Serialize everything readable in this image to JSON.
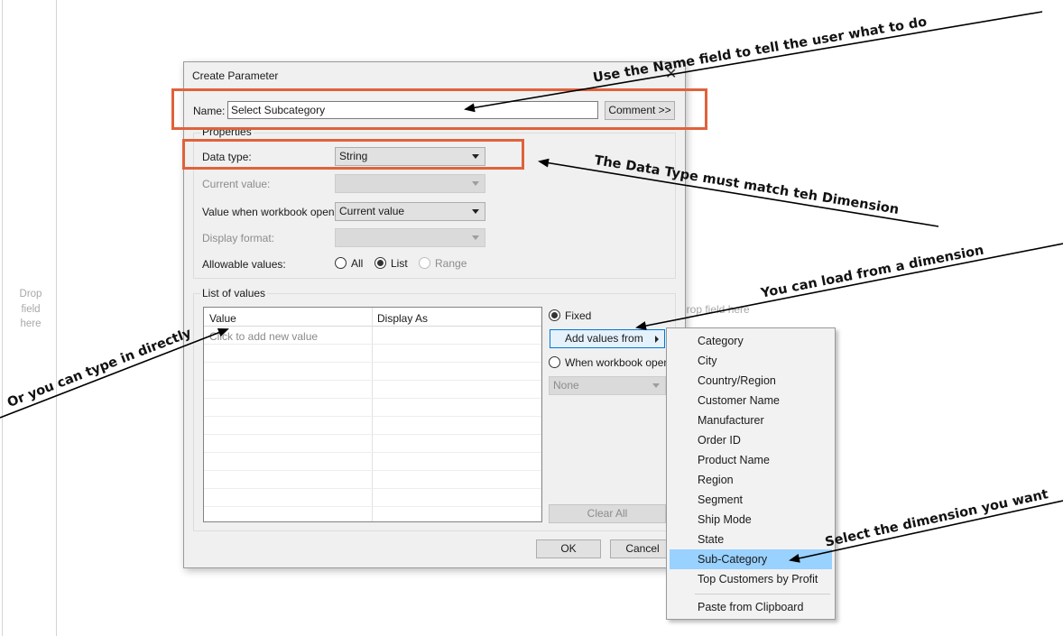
{
  "workspace": {
    "drop_hint_left": "Drop\nfield\nhere",
    "drop_hint_right": "Drop field here"
  },
  "dialog": {
    "title": "Create Parameter",
    "close_glyph": "✕",
    "name_label": "Name:",
    "name_value": "Select Subcategory",
    "comment_button": "Comment >>",
    "properties_label": "Properties",
    "data_type_label": "Data type:",
    "data_type_value": "String",
    "current_value_label": "Current value:",
    "current_value_value": "",
    "value_when_opens_label": "Value when workbook opens:",
    "value_when_opens_value": "Current value",
    "display_format_label": "Display format:",
    "display_format_value": "",
    "allowable_values_label": "Allowable values:",
    "allowable_options": [
      {
        "label": "All",
        "checked": false,
        "disabled": false
      },
      {
        "label": "List",
        "checked": true,
        "disabled": false
      },
      {
        "label": "Range",
        "checked": false,
        "disabled": true
      }
    ],
    "list_of_values_label": "List of values",
    "grid": {
      "columns": [
        "Value",
        "Display As"
      ],
      "placeholder": "Click to add new value"
    },
    "fixed_label": "Fixed",
    "add_values_button": "Add values from",
    "when_workbook_opens_label": "When workbook opens",
    "none_combo_value": "None",
    "clear_all_button": "Clear All",
    "ok_button": "OK",
    "cancel_button": "Cancel"
  },
  "add_values_menu": {
    "items": [
      "Category",
      "City",
      "Country/Region",
      "Customer Name",
      "Manufacturer",
      "Order ID",
      "Product Name",
      "Region",
      "Segment",
      "Ship Mode",
      "State",
      "Sub-Category",
      "Top Customers by Profit"
    ],
    "selected": "Sub-Category",
    "paste_item": "Paste from Clipboard"
  },
  "annotations": {
    "name_tip": "Use the Name field to tell the user what to do",
    "data_type_tip": "The Data Type must match teh Dimension",
    "load_tip": "You can load from a dimension",
    "type_tip": "Or you can type in directly",
    "select_tip": "Select the dimension you want",
    "highlight_color": "#e0623a",
    "menu_highlight_color": "#99d1ff"
  }
}
